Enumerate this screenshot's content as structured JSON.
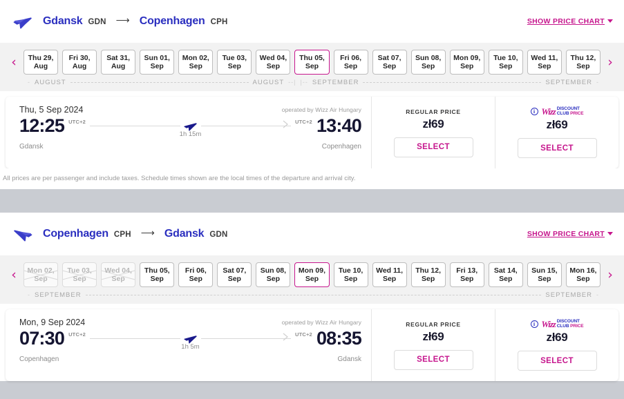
{
  "theme": {
    "accent_pink": "#c6168d",
    "brand_blue": "#2a2ebf",
    "page_background": "#c9ccd2",
    "card_background": "#ffffff"
  },
  "outbound": {
    "origin_city": "Gdansk",
    "origin_code": "GDN",
    "route_arrow": "⟶",
    "destination_city": "Copenhagen",
    "destination_code": "CPH",
    "plane_icon": "plane-right-icon",
    "price_chart_link": "SHOW PRICE CHART",
    "nav_prev": "‹",
    "nav_next": "›",
    "dates": [
      {
        "day": "Thu 29,",
        "month": "Aug",
        "state": "normal"
      },
      {
        "day": "Fri 30,",
        "month": "Aug",
        "state": "normal"
      },
      {
        "day": "Sat 31,",
        "month": "Aug",
        "state": "normal"
      },
      {
        "day": "Sun 01,",
        "month": "Sep",
        "state": "normal"
      },
      {
        "day": "Mon 02,",
        "month": "Sep",
        "state": "normal"
      },
      {
        "day": "Tue 03,",
        "month": "Sep",
        "state": "normal"
      },
      {
        "day": "Wed 04,",
        "month": "Sep",
        "state": "normal"
      },
      {
        "day": "Thu 05,",
        "month": "Sep",
        "state": "selected"
      },
      {
        "day": "Fri 06,",
        "month": "Sep",
        "state": "normal"
      },
      {
        "day": "Sat 07,",
        "month": "Sep",
        "state": "normal"
      },
      {
        "day": "Sun 08,",
        "month": "Sep",
        "state": "normal"
      },
      {
        "day": "Mon 09,",
        "month": "Sep",
        "state": "normal"
      },
      {
        "day": "Tue 10,",
        "month": "Sep",
        "state": "normal"
      },
      {
        "day": "Wed 11,",
        "month": "Sep",
        "state": "normal"
      },
      {
        "day": "Thu 12,",
        "month": "Sep",
        "state": "normal"
      }
    ],
    "month_markers": [
      "AUGUST",
      "AUGUST",
      "SEPTEMBER",
      "SEPTEMBER"
    ],
    "flight": {
      "date": "Thu, 5 Sep 2024",
      "operated_by": "operated by Wizz Air Hungary",
      "depart_time": "12:25",
      "depart_utc": "UTC+2",
      "depart_city": "Gdansk",
      "arrive_time": "13:40",
      "arrive_utc": "UTC+2",
      "arrive_city": "Copenhagen",
      "duration": "1h 15m",
      "regular": {
        "label": "REGULAR PRICE",
        "price": "zł69",
        "select_label": "SELECT"
      },
      "discount_club": {
        "logo_script": "Wizz",
        "logo_line1": "DISCOUNT",
        "logo_line2_a": "CLUB ",
        "logo_line2_b": "PRICE",
        "info_icon": "i",
        "price": "zł69",
        "select_label": "SELECT"
      }
    },
    "disclaimer": "All prices are per passenger and include taxes. Schedule times shown are the local times of the departure and arrival city."
  },
  "inbound": {
    "origin_city": "Copenhagen",
    "origin_code": "CPH",
    "route_arrow": "⟶",
    "destination_city": "Gdansk",
    "destination_code": "GDN",
    "plane_icon": "plane-left-icon",
    "price_chart_link": "SHOW PRICE CHART",
    "nav_prev": "‹",
    "nav_next": "›",
    "dates": [
      {
        "day": "Mon 02,",
        "month": "Sep",
        "state": "disabled"
      },
      {
        "day": "Tue 03,",
        "month": "Sep",
        "state": "disabled"
      },
      {
        "day": "Wed 04,",
        "month": "Sep",
        "state": "disabled"
      },
      {
        "day": "Thu 05,",
        "month": "Sep",
        "state": "normal"
      },
      {
        "day": "Fri 06,",
        "month": "Sep",
        "state": "normal"
      },
      {
        "day": "Sat 07,",
        "month": "Sep",
        "state": "normal"
      },
      {
        "day": "Sun 08,",
        "month": "Sep",
        "state": "normal"
      },
      {
        "day": "Mon 09,",
        "month": "Sep",
        "state": "selected"
      },
      {
        "day": "Tue 10,",
        "month": "Sep",
        "state": "normal"
      },
      {
        "day": "Wed 11,",
        "month": "Sep",
        "state": "normal"
      },
      {
        "day": "Thu 12,",
        "month": "Sep",
        "state": "normal"
      },
      {
        "day": "Fri 13,",
        "month": "Sep",
        "state": "normal"
      },
      {
        "day": "Sat 14,",
        "month": "Sep",
        "state": "normal"
      },
      {
        "day": "Sun 15,",
        "month": "Sep",
        "state": "normal"
      },
      {
        "day": "Mon 16,",
        "month": "Sep",
        "state": "normal"
      }
    ],
    "month_markers": [
      "SEPTEMBER",
      "SEPTEMBER"
    ],
    "flight": {
      "date": "Mon, 9 Sep 2024",
      "operated_by": "operated by Wizz Air Hungary",
      "depart_time": "07:30",
      "depart_utc": "UTC+2",
      "depart_city": "Copenhagen",
      "arrive_time": "08:35",
      "arrive_utc": "UTC+2",
      "arrive_city": "Gdansk",
      "duration": "1h 5m",
      "regular": {
        "label": "REGULAR PRICE",
        "price": "zł69",
        "select_label": "SELECT"
      },
      "discount_club": {
        "logo_script": "Wizz",
        "logo_line1": "DISCOUNT",
        "logo_line2_a": "CLUB ",
        "logo_line2_b": "PRICE",
        "info_icon": "i",
        "price": "zł69",
        "select_label": "SELECT"
      }
    }
  }
}
